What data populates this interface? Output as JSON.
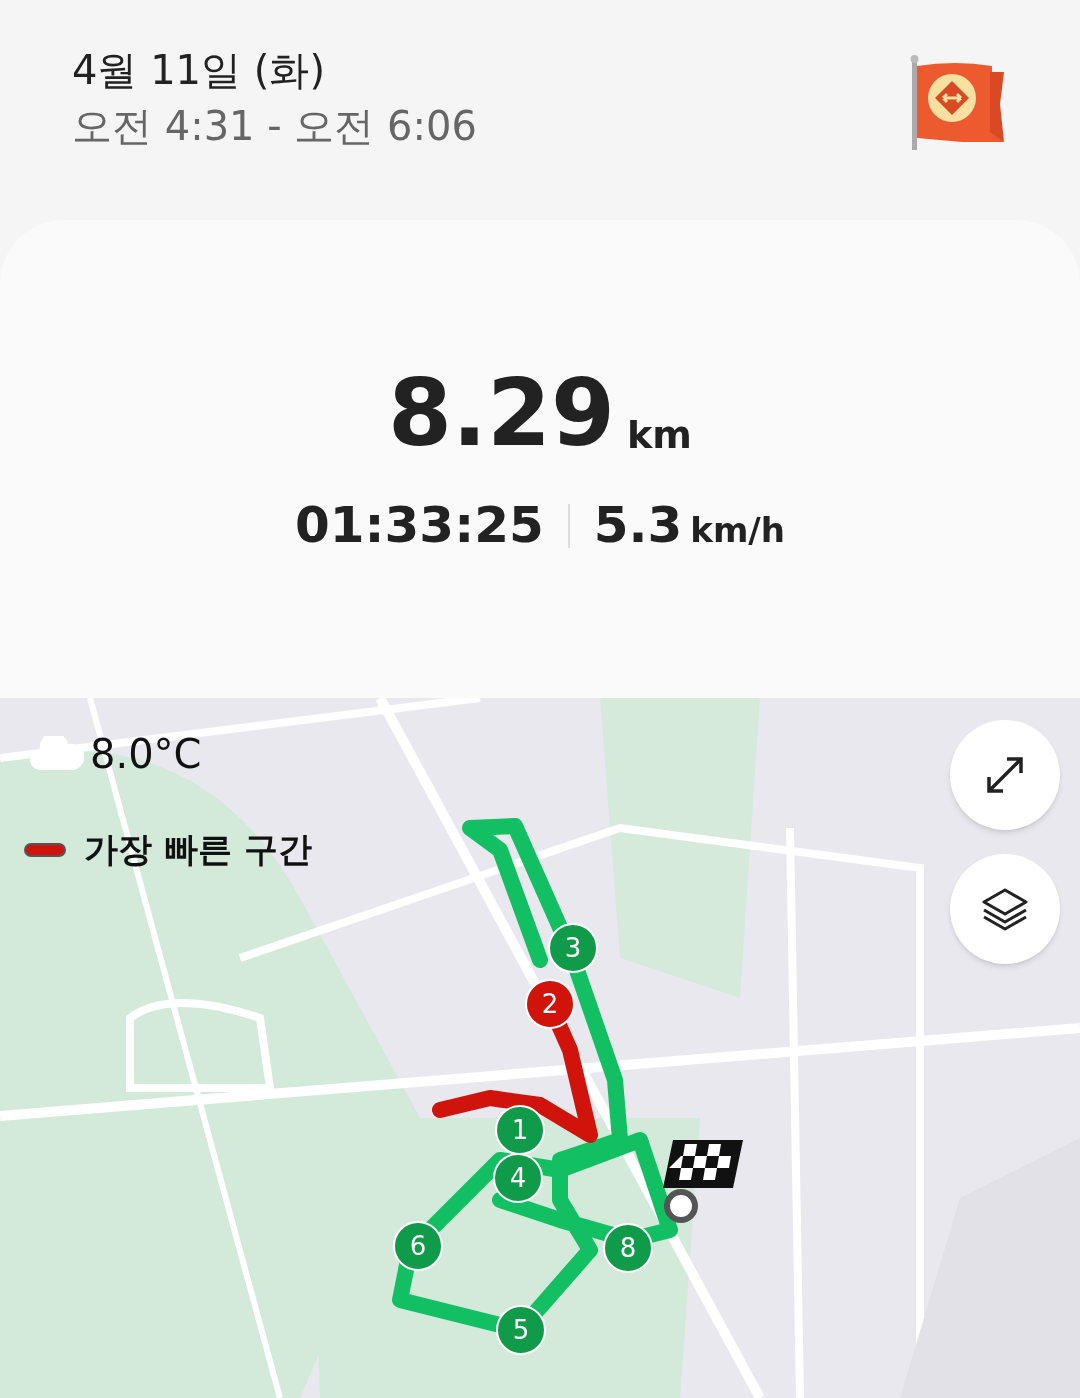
{
  "header": {
    "date": "4월 11일 (화)",
    "time_range": "오전 4:31 - 오전 6:06"
  },
  "summary": {
    "distance": "8.29",
    "distance_unit": "km",
    "duration": "01:33:25",
    "speed": "5.3",
    "speed_unit": "km/h"
  },
  "map": {
    "weather": {
      "temperature": "8.0°C"
    },
    "legend": {
      "label": "가장 빠른 구간",
      "color": "#d0140c"
    },
    "buttons": [
      {
        "kind": "expand"
      },
      {
        "kind": "layers"
      }
    ],
    "markers": [
      {
        "label": "1",
        "color": "#0f9b49"
      },
      {
        "label": "2",
        "color": "#d0140c"
      },
      {
        "label": "3",
        "color": "#0f9b49"
      },
      {
        "label": "4",
        "color": "#0f9b49"
      },
      {
        "label": "5",
        "color": "#0f9b49"
      },
      {
        "label": "6",
        "color": "#0f9b49"
      },
      {
        "label": "8",
        "color": "#0f9b49"
      }
    ]
  }
}
